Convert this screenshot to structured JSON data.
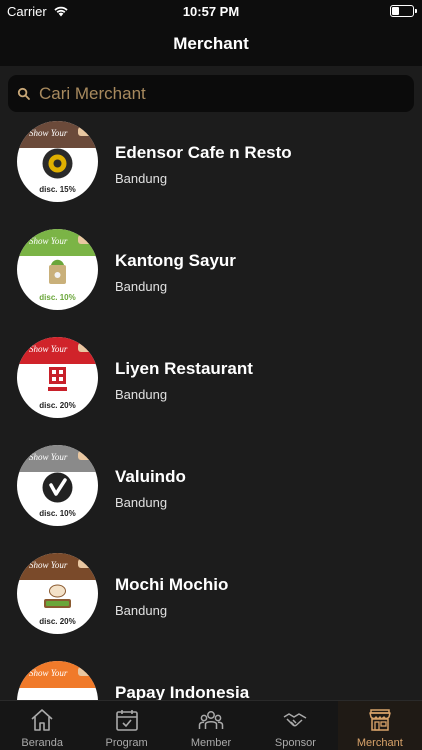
{
  "status_bar": {
    "carrier": "Carrier",
    "time": "10:57 PM"
  },
  "nav": {
    "title": "Merchant"
  },
  "search": {
    "placeholder": "Cari Merchant"
  },
  "merchants": [
    {
      "name": "Edensor Cafe n Resto",
      "city": "Bandung",
      "discount": "disc. 15%",
      "band_color": "#6b4a3a",
      "logo_color": "#e0b000"
    },
    {
      "name": "Kantong Sayur",
      "city": "Bandung",
      "discount": "disc. 10%",
      "band_color": "#7bb446",
      "logo_color": "#6aa63a"
    },
    {
      "name": "Liyen Restaurant",
      "city": "Bandung",
      "discount": "disc. 20%",
      "band_color": "#d0232a",
      "logo_color": "#c8202a"
    },
    {
      "name": "Valuindo",
      "city": "Bandung",
      "discount": "disc. 10%",
      "band_color": "#8a8a8a",
      "logo_color": "#222222"
    },
    {
      "name": "Mochi Mochio",
      "city": "Bandung",
      "discount": "disc. 20%",
      "band_color": "#7a4a2a",
      "logo_color": "#8a5a30"
    },
    {
      "name": "Papay Indonesia",
      "city": "",
      "discount": "",
      "band_color": "#f07a2a",
      "logo_color": "#f07a2a"
    }
  ],
  "tabs": [
    {
      "label": "Beranda",
      "icon": "home-icon"
    },
    {
      "label": "Program",
      "icon": "calendar-icon"
    },
    {
      "label": "Member",
      "icon": "group-icon"
    },
    {
      "label": "Sponsor",
      "icon": "handshake-icon"
    },
    {
      "label": "Merchant",
      "icon": "store-icon",
      "active": true
    }
  ],
  "colors": {
    "accent": "#d9a36a",
    "background": "#1c1c1c",
    "bar": "#0d0d0d"
  }
}
